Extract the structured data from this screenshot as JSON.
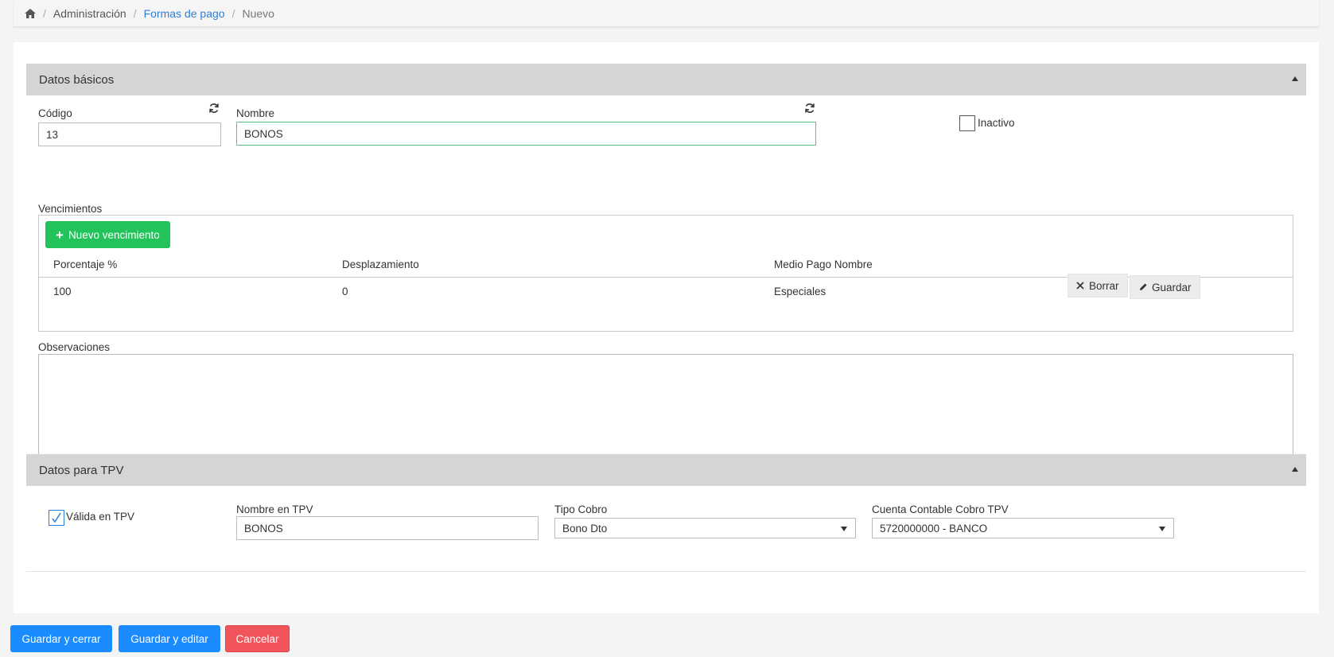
{
  "breadcrumb": {
    "home_icon": "home-icon",
    "items": [
      "Administración",
      "Formas de pago",
      "Nuevo"
    ]
  },
  "basic": {
    "title": "Datos básicos",
    "codigo_label": "Código",
    "codigo_value": "13",
    "nombre_label": "Nombre",
    "nombre_value": "BONOS",
    "inactivo_label": "Inactivo",
    "inactivo_checked": false,
    "vencimientos_label": "Vencimientos",
    "nuevo_vencimiento_label": "Nuevo vencimiento",
    "columns": [
      "Porcentaje %",
      "Desplazamiento",
      "Medio Pago Nombre"
    ],
    "rows": [
      {
        "porcentaje": "100",
        "desplazamiento": "0",
        "medio": "Especiales"
      }
    ],
    "borrar_label": "Borrar",
    "guardar_label": "Guardar",
    "observaciones_label": "Observaciones",
    "observaciones_value": ""
  },
  "tpv": {
    "title": "Datos para TPV",
    "valida_label": "Válida en TPV",
    "valida_checked": true,
    "nombre_tpv_label": "Nombre en TPV",
    "nombre_tpv_value": "BONOS",
    "tipo_cobro_label": "Tipo Cobro",
    "tipo_cobro_value": "Bono Dto",
    "cuenta_label": "Cuenta Contable Cobro TPV",
    "cuenta_value": "5720000000 - BANCO"
  },
  "footer": {
    "save_close": "Guardar y cerrar",
    "save_edit": "Guardar y editar",
    "cancel": "Cancelar"
  },
  "colors": {
    "green": "#22c35a",
    "blue": "#1a8cff",
    "red": "#f2545b",
    "link": "#2c7fd6"
  }
}
